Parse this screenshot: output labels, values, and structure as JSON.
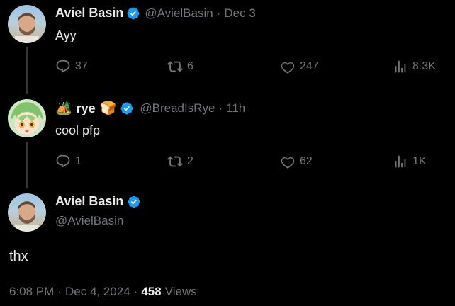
{
  "colors": {
    "accent": "#1d9bf0",
    "muted": "#71767b",
    "text": "#e7e9ea",
    "background": "#000000"
  },
  "tweet1": {
    "name": "Aviel Basin",
    "handle": "@AvielBasin",
    "sep": "·",
    "time": "Dec 3",
    "text": "Ayy",
    "replies": "37",
    "reposts": "6",
    "likes": "247",
    "views": "8.3K"
  },
  "tweet2": {
    "name": "rye",
    "handle": "@BreadIsRye",
    "sep": "·",
    "time": "11h",
    "text": "cool pfp",
    "replies": "1",
    "reposts": "2",
    "likes": "62",
    "views": "1K"
  },
  "main_tweet": {
    "name": "Aviel Basin",
    "handle": "@AvielBasin",
    "text": "thx",
    "time": "6:08 PM",
    "sep1": "·",
    "date": "Dec 4, 2024",
    "sep2": "·",
    "views_count": "458",
    "views_label": "Views"
  },
  "icons": [
    "verified-icon",
    "reply-icon",
    "repost-icon",
    "like-icon",
    "views-icon",
    "camping-emoji-icon",
    "bread-emoji-icon"
  ]
}
